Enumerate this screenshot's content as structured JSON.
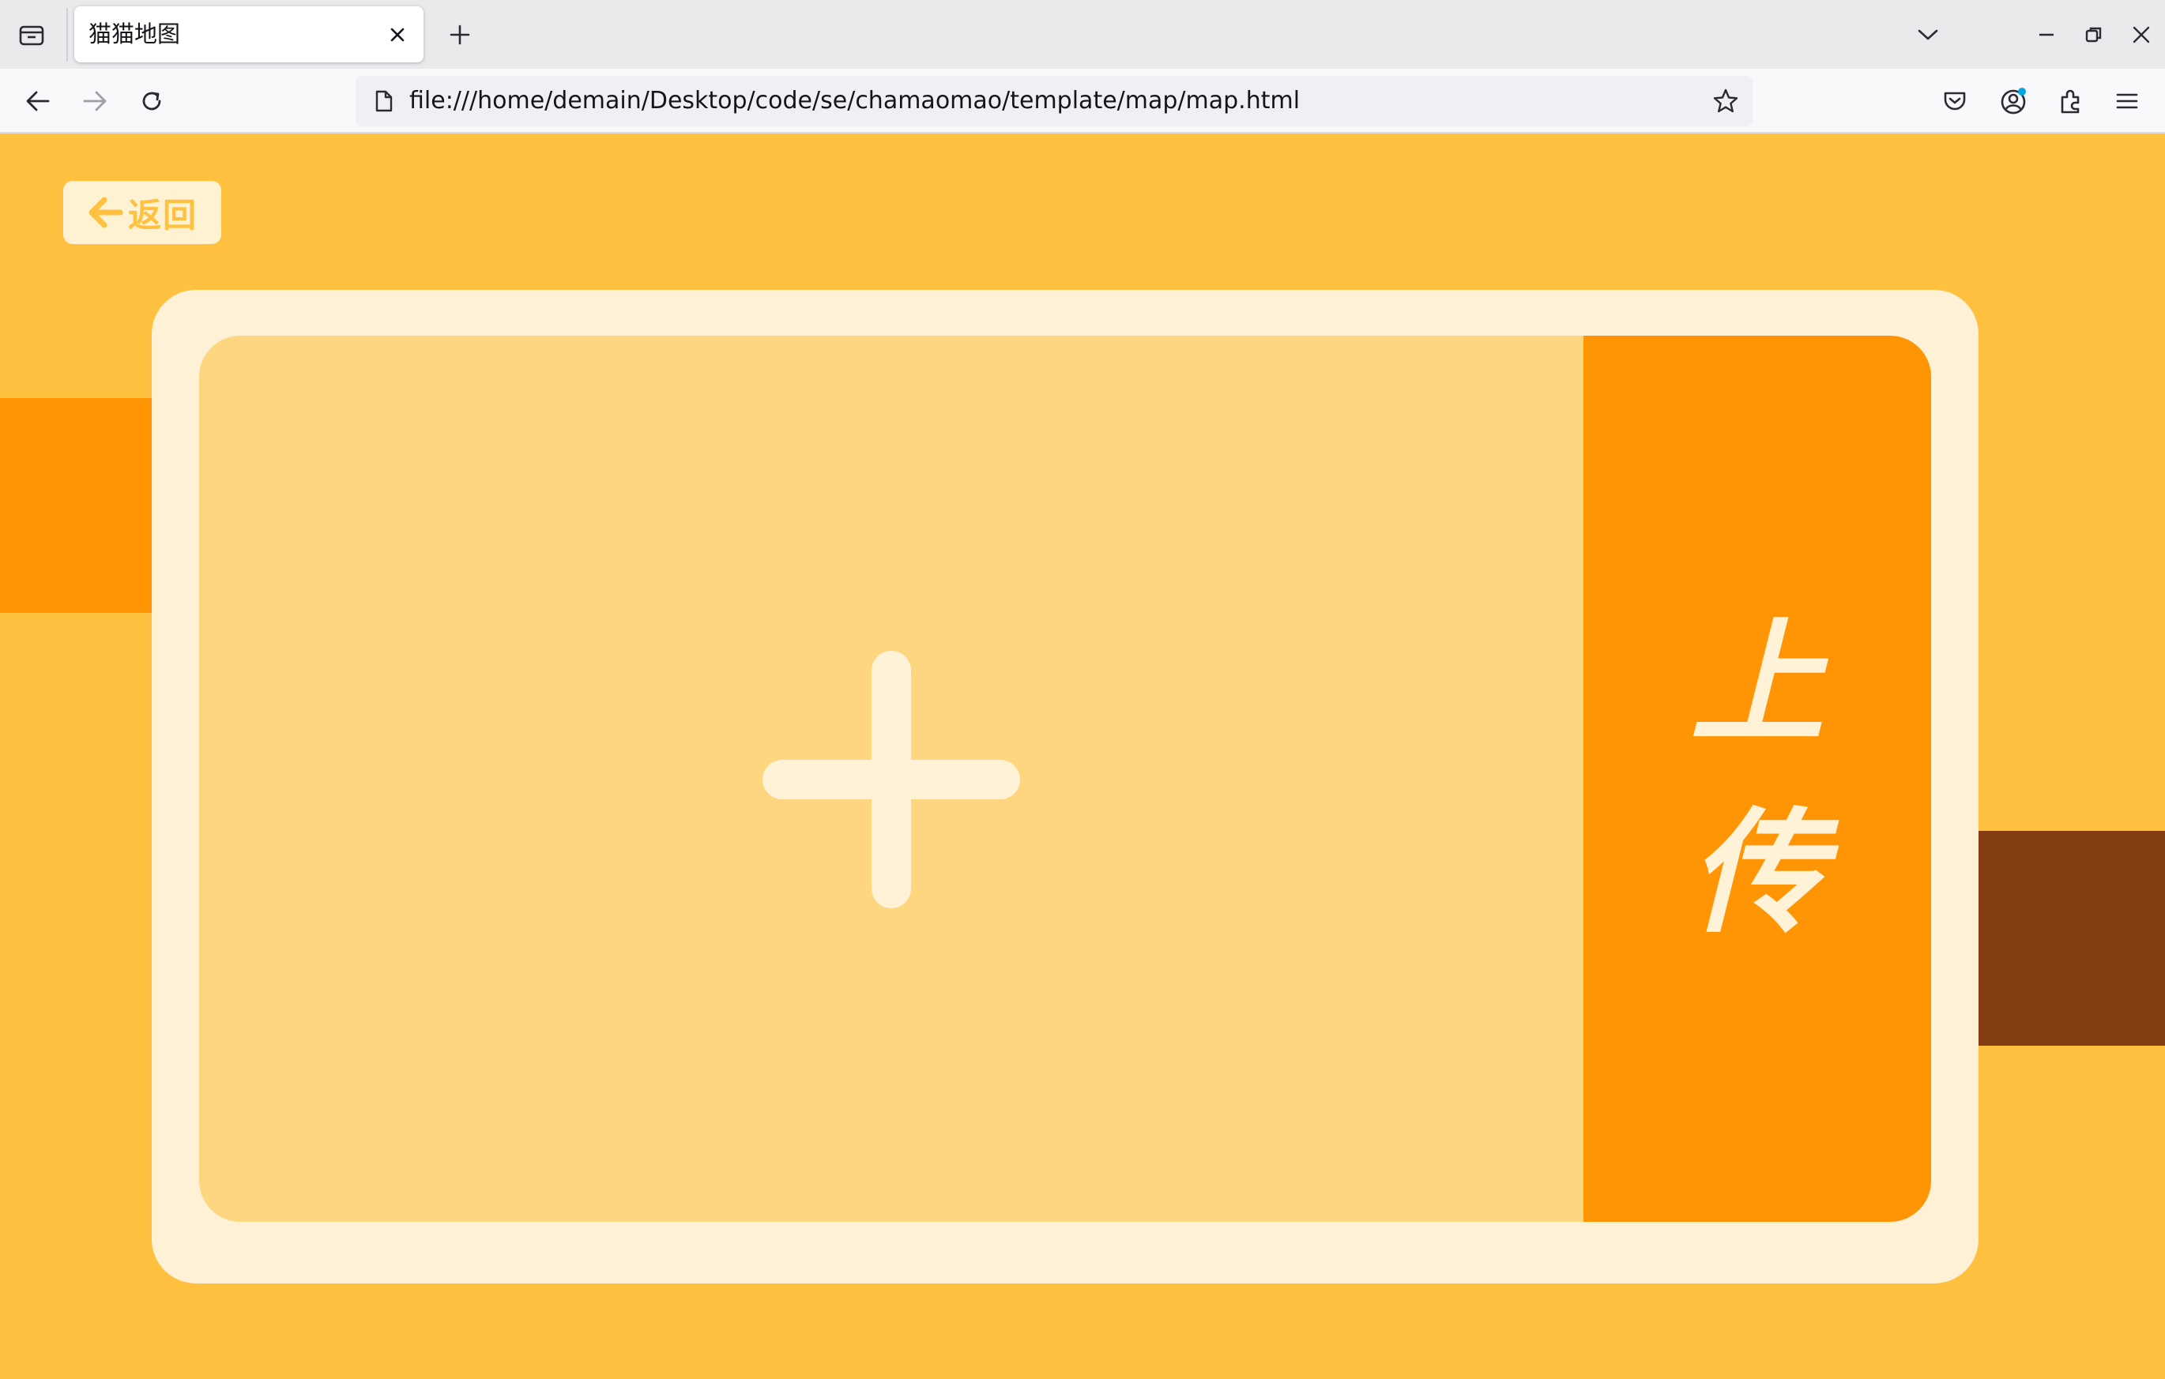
{
  "browser": {
    "tab": {
      "title": "猫猫地图"
    },
    "url": "file:///home/demain/Desktop/code/se/chamaomao/template/map/map.html"
  },
  "page": {
    "back_button": {
      "label": "返回"
    },
    "upload_button": {
      "chars": [
        "上",
        "传"
      ]
    }
  },
  "colors": {
    "background": "#ffc13f",
    "card": "#fff1d5",
    "drop_zone": "#ffd680",
    "accent_orange": "#ff9505",
    "accent_brown": "#843d12"
  }
}
